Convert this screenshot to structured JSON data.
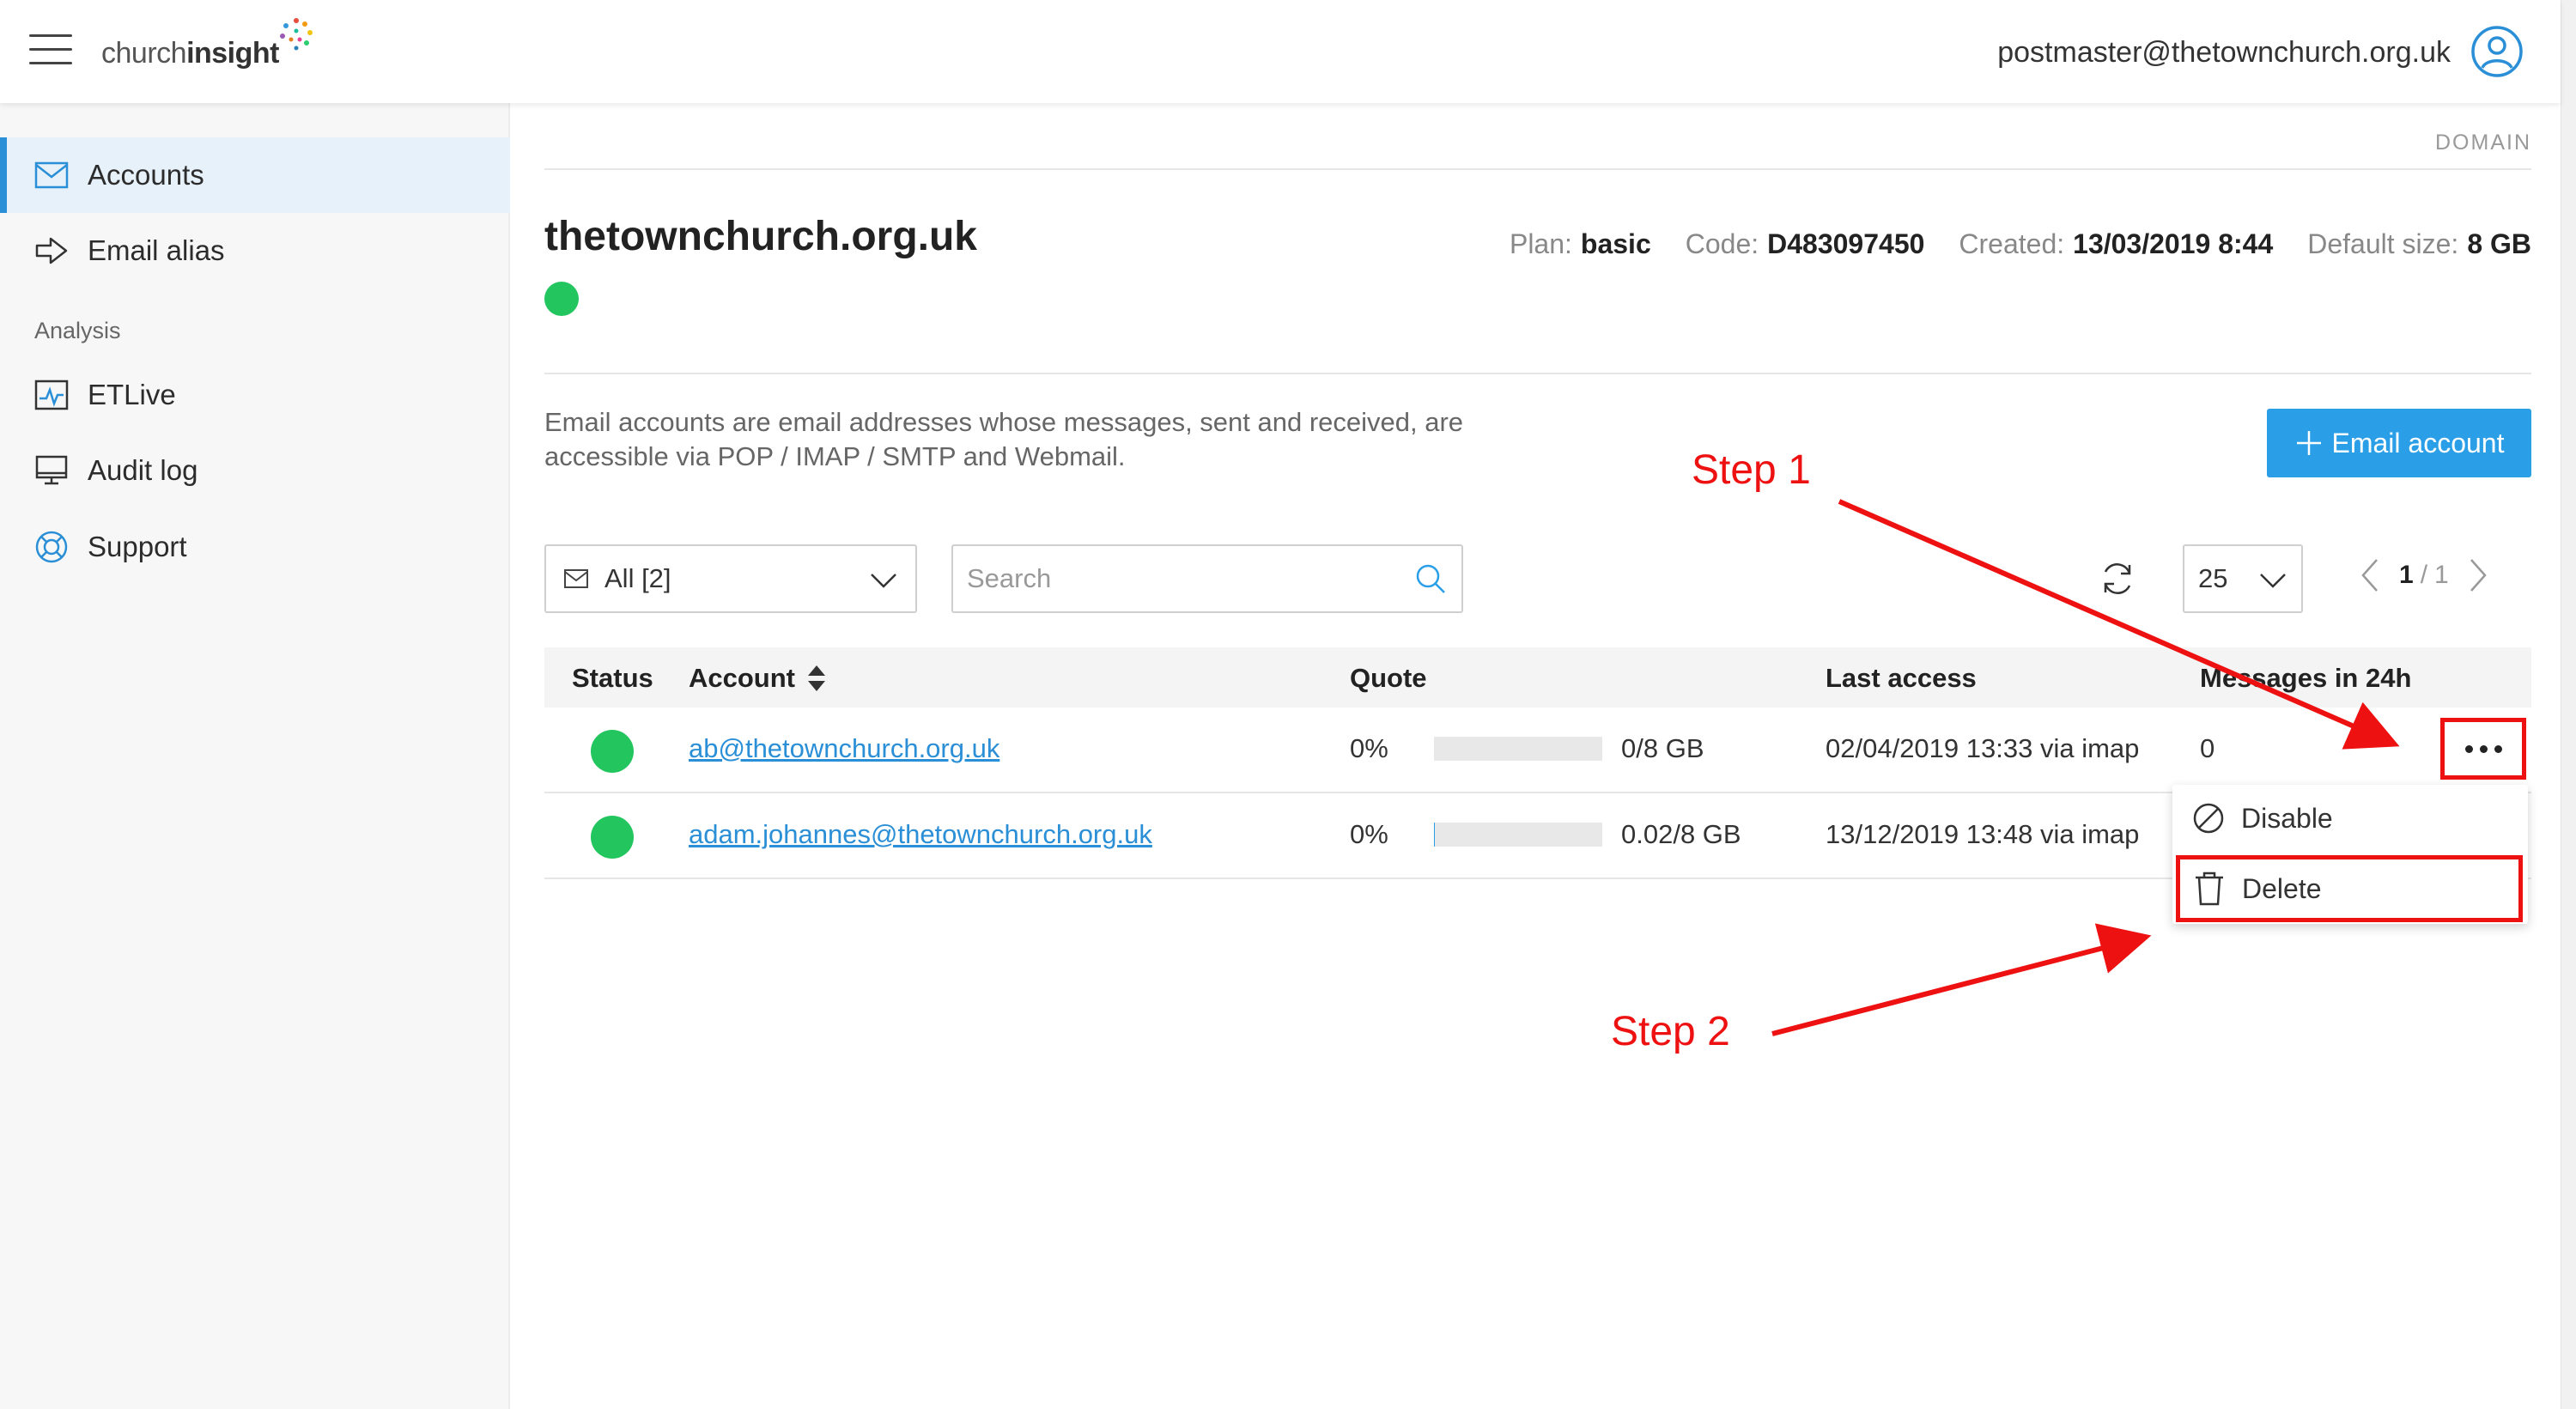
{
  "header": {
    "logo_light": "church",
    "logo_bold": "insight",
    "user_email": "postmaster@thetownchurch.org.uk"
  },
  "sidebar": {
    "items": [
      {
        "label": "Accounts",
        "icon": "mail-icon"
      },
      {
        "label": "Email alias",
        "icon": "forward-arrow-icon"
      },
      {
        "label": "ETLive",
        "icon": "activity-chart-icon"
      },
      {
        "label": "Audit log",
        "icon": "monitor-icon"
      },
      {
        "label": "Support",
        "icon": "lifebuoy-icon"
      }
    ],
    "section_analysis": "Analysis"
  },
  "main": {
    "section_tag": "DOMAIN",
    "domain": "thetownchurch.org.uk",
    "meta": {
      "plan_label": "Plan:",
      "plan_value": "basic",
      "code_label": "Code:",
      "code_value": "D483097450",
      "created_label": "Created:",
      "created_value": "13/03/2019 8:44",
      "default_size_label": "Default size:",
      "default_size_value": "8 GB"
    },
    "description": "Email accounts are email addresses whose messages, sent and received, are accessible via POP / IMAP / SMTP and Webmail.",
    "add_button": "Email account",
    "filter_value": "All [2]",
    "search_placeholder": "Search",
    "per_page": "25",
    "pager": {
      "current": "1",
      "separator": "/",
      "total": "1"
    }
  },
  "table": {
    "headers": {
      "status": "Status",
      "account": "Account",
      "quote": "Quote",
      "last_access": "Last access",
      "messages": "Messages in 24h"
    },
    "rows": [
      {
        "account": "ab@thetownchurch.org.uk",
        "quota_pct": "0%",
        "quota_fill": 0,
        "quota_used": "0/8 GB",
        "last_access": "02/04/2019 13:33 via imap",
        "messages": "0"
      },
      {
        "account": "adam.johannes@thetownchurch.org.uk",
        "quota_pct": "0%",
        "quota_fill": 0.0025,
        "quota_used": "0.02/8 GB",
        "last_access": "13/12/2019 13:48 via imap",
        "messages": ""
      }
    ]
  },
  "row_menu": {
    "disable": "Disable",
    "delete": "Delete"
  },
  "annotations": {
    "step1": "Step 1",
    "step2": "Step 2",
    "color": "#ee1111"
  },
  "colors": {
    "accent": "#2a9fe8",
    "status_active": "#22c55e",
    "link": "#2a8fd6"
  }
}
